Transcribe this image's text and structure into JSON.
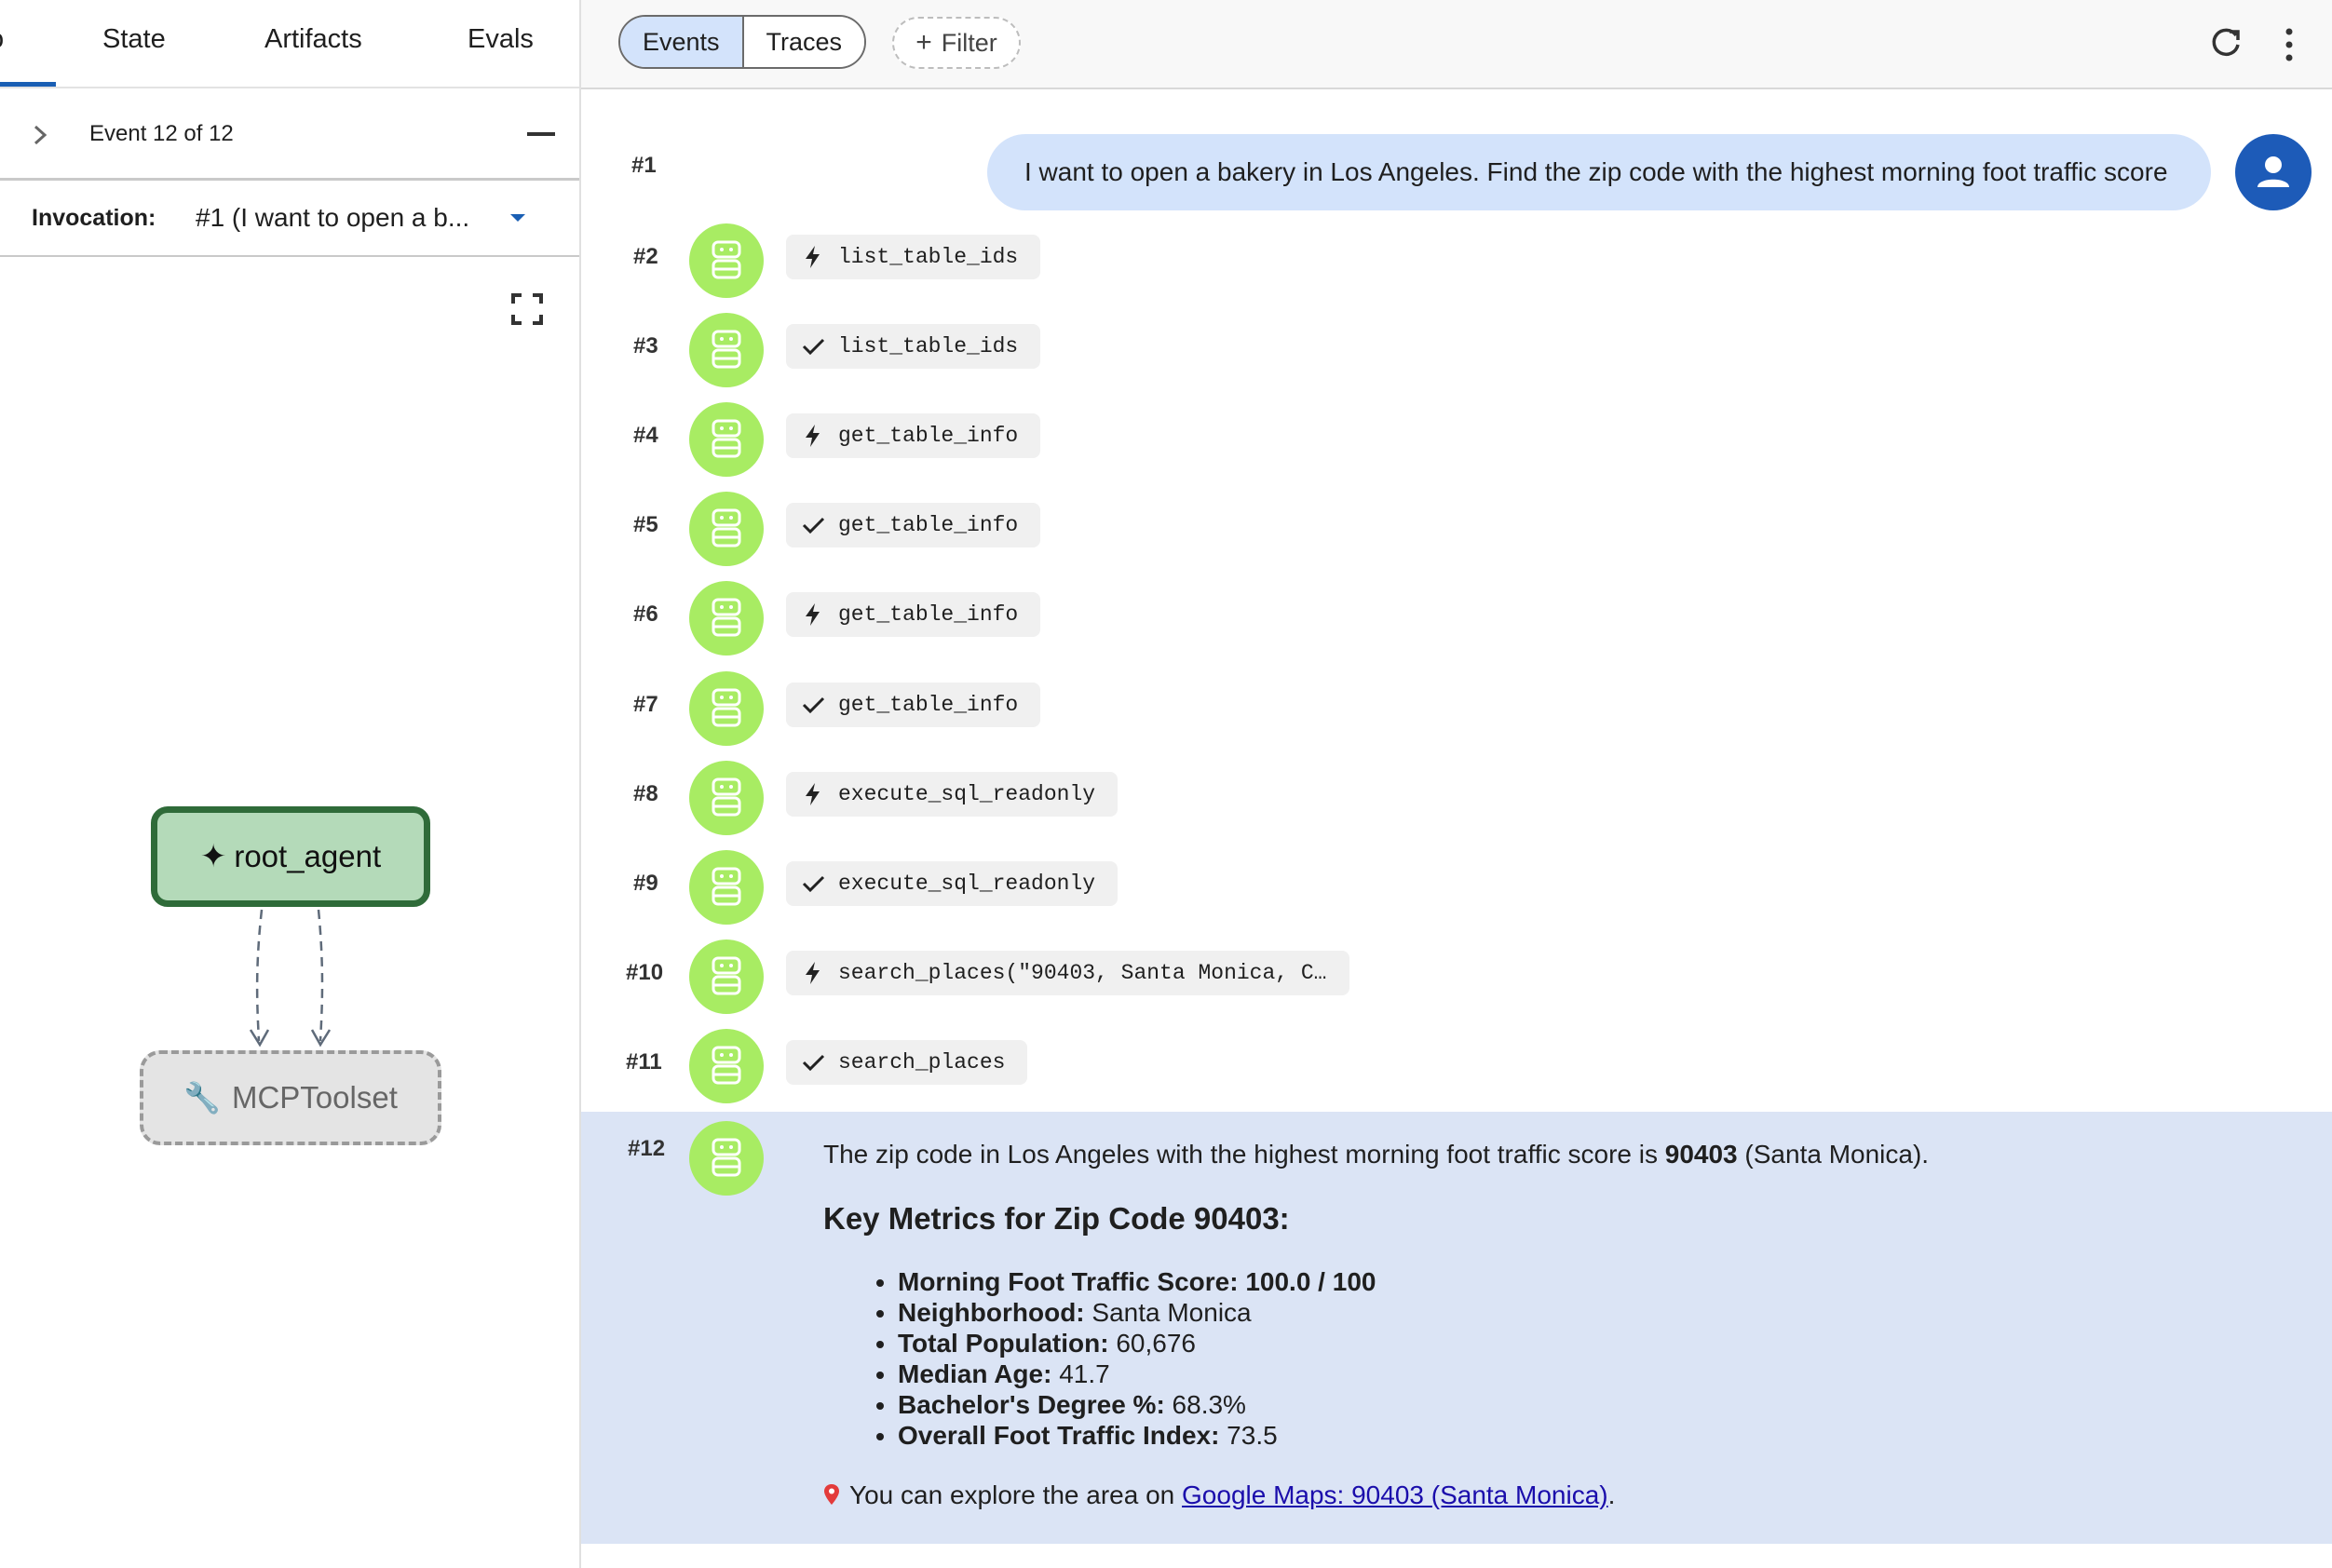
{
  "left_tabs": {
    "stub": "o",
    "state": "State",
    "artifacts": "Artifacts",
    "evals": "Evals"
  },
  "event_nav": {
    "label": "Event 12 of 12"
  },
  "invocation": {
    "label": "Invocation:",
    "value": "#1 (I want to open a b..."
  },
  "graph": {
    "root_node": "root_agent",
    "tool_node": "MCPToolset"
  },
  "topbar": {
    "events_tab": "Events",
    "traces_tab": "Traces",
    "filter_label": "Filter"
  },
  "user_message": {
    "number": "#1",
    "text": "I want to open a bakery in Los Angeles. Find the zip code with the highest morning foot traffic score"
  },
  "events": [
    {
      "number": "#2",
      "kind": "call",
      "label": "list_table_ids"
    },
    {
      "number": "#3",
      "kind": "result",
      "label": "list_table_ids"
    },
    {
      "number": "#4",
      "kind": "call",
      "label": "get_table_info"
    },
    {
      "number": "#5",
      "kind": "result",
      "label": "get_table_info"
    },
    {
      "number": "#6",
      "kind": "call",
      "label": "get_table_info"
    },
    {
      "number": "#7",
      "kind": "result",
      "label": "get_table_info"
    },
    {
      "number": "#8",
      "kind": "call",
      "label": "execute_sql_readonly"
    },
    {
      "number": "#9",
      "kind": "result",
      "label": "execute_sql_readonly"
    },
    {
      "number": "#10",
      "kind": "call",
      "label": "search_places(\"90403, Santa Monica, C…"
    },
    {
      "number": "#11",
      "kind": "result",
      "label": "search_places"
    }
  ],
  "final_response": {
    "number": "#12",
    "intro_before": "The zip code in Los Angeles with the highest morning foot traffic score is ",
    "intro_bold": "90403",
    "intro_after": " (Santa Monica).",
    "heading": "Key Metrics for Zip Code 90403:",
    "metrics": [
      {
        "label": "Morning Foot Traffic Score: 100.0 / 100",
        "value": ""
      },
      {
        "label": "Neighborhood:",
        "value": " Santa Monica"
      },
      {
        "label": "Total Population:",
        "value": " 60,676"
      },
      {
        "label": "Median Age:",
        "value": " 41.7"
      },
      {
        "label": "Bachelor's Degree %:",
        "value": " 68.3%"
      },
      {
        "label": "Overall Foot Traffic Index:",
        "value": " 73.5"
      }
    ],
    "explore_before": "You can explore the area on ",
    "explore_link": "Google Maps: 90403 (Santa Monica)",
    "explore_after": "."
  },
  "colors": {
    "agent_avatar": "#a8ec63",
    "user_bubble": "#d3e3fb",
    "user_avatar": "#1d5bb8",
    "final_bg": "#dbe4f5",
    "root_node_fill": "#b4dab9",
    "root_node_border": "#2f6b39"
  }
}
